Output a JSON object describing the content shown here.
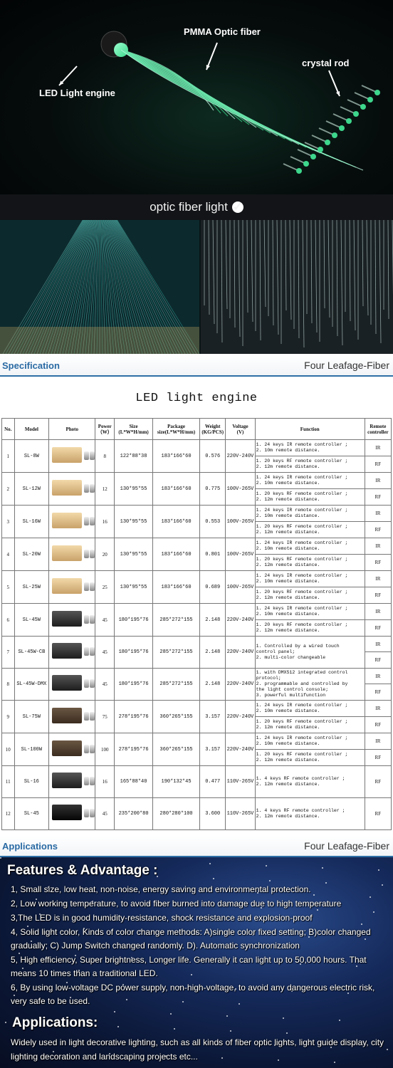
{
  "hero": {
    "label_fiber": "PMMA Optic fiber",
    "label_engine": "LED Light engine",
    "label_rod": "crystal rod",
    "accent_color": "#3dd68c"
  },
  "caption": {
    "text": "optic fiber light",
    "icon": "check-circle-icon"
  },
  "spec_bar": {
    "title": "Specification",
    "brand": "Four  Leafage-Fiber"
  },
  "apps_bar": {
    "title": "Applications",
    "brand": "Four  Leafage-Fiber"
  },
  "table": {
    "title": "LED light engine",
    "headers": {
      "no": "No.",
      "model": "Model",
      "photo": "Photo",
      "power": "Power\n（W）",
      "size": "Size\n(L*W*H/mm)",
      "package": "Package\nsize(L*W*H/mm)",
      "weight": "Weight\n(KG/PCS)",
      "voltage": "Voltage\n(V)",
      "function": "Function",
      "remote": "Remote\ncontroller"
    },
    "rows": [
      {
        "no": "1",
        "model": "SL-8W",
        "photo": "gold",
        "power": "8",
        "size": "122*88*38",
        "package": "183*166*60",
        "weight": "0.576",
        "voltage": "220V-240V",
        "f1": "1. 24 keys IR remote controller ;\n2. 10m remote distance.",
        "r1": "IR",
        "f2": "1. 20 keys RF remote controller ;\n2. 12m  remote distance.",
        "r2": "RF"
      },
      {
        "no": "2",
        "model": "SL-12W",
        "photo": "gold",
        "power": "12",
        "size": "130*95*55",
        "package": "183*166*60",
        "weight": "0.775",
        "voltage": "100V-265V",
        "f1": "1. 24 keys IR remote controller ;\n2. 10m remote distance.",
        "r1": "IR",
        "f2": "1. 20 keys RF remote controller ;\n2. 12m  remote distance.",
        "r2": "RF"
      },
      {
        "no": "3",
        "model": "SL-16W",
        "photo": "gold",
        "power": "16",
        "size": "130*95*55",
        "package": "183*166*60",
        "weight": "0.553",
        "voltage": "100V-265V",
        "f1": "1. 24 keys IR remote controller ;\n2. 10m remote distance.",
        "r1": "IR",
        "f2": "1. 20 keys RF remote controller ;\n2. 12m  remote distance.",
        "r2": "RF"
      },
      {
        "no": "4",
        "model": "SL-20W",
        "photo": "gold",
        "power": "20",
        "size": "130*95*55",
        "package": "183*166*60",
        "weight": "0.801",
        "voltage": "100V-265V",
        "f1": "1. 24 keys IR remote controller ;\n2. 10m remote distance.",
        "r1": "IR",
        "f2": "1. 20 keys RF remote controller ;\n2. 12m  remote distance.",
        "r2": "RF"
      },
      {
        "no": "5",
        "model": "SL-25W",
        "photo": "gold",
        "power": "25",
        "size": "130*95*55",
        "package": "183*166*60",
        "weight": "0.689",
        "voltage": "100V-265V",
        "f1": "1. 24 keys IR remote controller ;\n2. 10m remote distance.",
        "r1": "IR",
        "f2": "1. 20 keys RF remote controller ;\n2. 12m  remote distance.",
        "r2": "RF"
      },
      {
        "no": "6",
        "model": "SL-45W",
        "photo": "dark",
        "power": "45",
        "size": "180*195*76",
        "package": "285*272*155",
        "weight": "2.148",
        "voltage": "220V-240V",
        "f1": "1. 24 keys IR remote controller ;\n2. 10m remote distance.",
        "r1": "IR",
        "f2": "1. 20 keys RF remote controller ;\n2. 12m  remote distance.",
        "r2": "RF"
      },
      {
        "no": "7",
        "model": "SL-45W-CB",
        "photo": "dark",
        "power": "45",
        "size": "180*195*76",
        "package": "285*272*155",
        "weight": "2.148",
        "voltage": "220V-240V",
        "f1": "1. Controlled by a wired touch\ncontrol panel;\n2. multi-color changeable",
        "r1": "IR",
        "f2": "",
        "r2": "RF"
      },
      {
        "no": "8",
        "model": "SL-45W-DMX",
        "photo": "dark",
        "power": "45",
        "size": "180*195*76",
        "package": "285*272*155",
        "weight": "2.148",
        "voltage": "220V-240V",
        "f1": "1. with DMX512 integrated control\nprotocol;\n2. programmable and controlled by\nthe light control console;\n3. powerful multifunction",
        "r1": "IR",
        "f2": "",
        "r2": "RF"
      },
      {
        "no": "9",
        "model": "SL-75W",
        "photo": "brown",
        "power": "75",
        "size": "278*195*76",
        "package": "360*265*155",
        "weight": "3.157",
        "voltage": "220V-240V",
        "f1": "1. 24 keys IR remote controller ;\n2. 10m remote distance.",
        "r1": "IR",
        "f2": "1. 20 keys RF remote controller ;\n2. 12m  remote distance.",
        "r2": "RF"
      },
      {
        "no": "10",
        "model": "SL-100W",
        "photo": "brown",
        "power": "100",
        "size": "278*195*76",
        "package": "360*265*155",
        "weight": "3.157",
        "voltage": "220V-240V",
        "f1": "1. 24 keys IR remote controller ;\n2. 10m remote distance.",
        "r1": "IR",
        "f2": "1. 20 keys RF remote controller ;\n2. 12m  remote distance.",
        "r2": "RF"
      },
      {
        "no": "11",
        "model": "SL-16",
        "photo": "dark",
        "power": "16",
        "size": "165*88*40",
        "package": "190*132*45",
        "weight": "0.477",
        "voltage": "110V-265V",
        "f1": "1. 4 keys RF remote controller ;\n2. 12m remote distance.",
        "r1": "RF",
        "f2": null,
        "r2": null
      },
      {
        "no": "12",
        "model": "SL-45",
        "photo": "black",
        "power": "45",
        "size": "235*200*80",
        "package": "280*280*100",
        "weight": "3.600",
        "voltage": "110V-265V",
        "f1": "1. 4 keys RF remote controller ;\n2. 12m remote distance.",
        "r1": "RF",
        "f2": null,
        "r2": null
      }
    ]
  },
  "features": {
    "title": "Features & Advantage :",
    "items": [
      "1, Small size, low heat, non-noise, energy saving and environmental protection.",
      "2, Low working temperature, to avoid fiber burned into damage due to high temperature",
      "3,The LED is in good humidity-resistance, shock resistance and explosion-proof",
      "4, Solid light color, Kinds of color change methods: A)single color fixed setting;  B)color changed gradually;  C) Jump Switch changed randomly.  D). Automatic synchronization",
      "5, High efficiency, Super brightness, Longer life. Generally it can light up to 50,000 hours. That means 10 times than a traditional LED.",
      "6, By using low-voltage DC power supply, non-high-voltage, to avoid any dangerous electric risk, very safe to be used."
    ]
  },
  "applications": {
    "title": "Applications:",
    "body": "Widely used in light decorative lighting, such as all kinds of fiber optic lights, light guide display, city lighting decoration and landscaping projects etc..."
  }
}
